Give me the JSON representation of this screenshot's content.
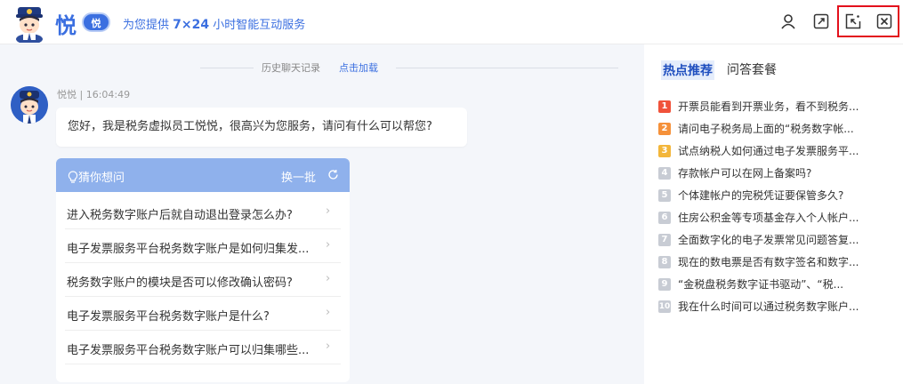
{
  "header": {
    "brand": "悦",
    "badge": "悦",
    "slogan_pre": "为您提供 ",
    "slogan_bold": "7×24",
    "slogan_post": " 小时智能互动服务"
  },
  "chat": {
    "history_text": "历史聊天记录",
    "history_link": "点击加载",
    "meta": "悦悦 | 16:04:49",
    "greeting": "您好，我是税务虚拟员工悦悦，很高兴为您服务，请问有什么可以帮您?",
    "guess": {
      "title": "猜你想问",
      "refresh_label": "换一批",
      "items": [
        "进入税务数字账户后就自动退出登录怎么办?",
        "电子发票服务平台税务数字账户是如何归集发...",
        "税务数字账户的模块是否可以修改确认密码?",
        "电子发票服务平台税务数字账户是什么?",
        "电子发票服务平台税务数字账户可以归集哪些..."
      ],
      "arrow": "›"
    }
  },
  "right_panel": {
    "tabs": [
      "热点推荐",
      "问答套餐"
    ],
    "hot_items": [
      {
        "num": "1",
        "text": "开票员能看到开票业务，看不到税务..."
      },
      {
        "num": "2",
        "text": "请问电子税务局上面的“税务数字帐..."
      },
      {
        "num": "3",
        "text": "试点纳税人如何通过电子发票服务平..."
      },
      {
        "num": "4",
        "text": "存款帐户可以在网上备案吗?"
      },
      {
        "num": "5",
        "text": "个体建帐户的完税凭证要保管多久?"
      },
      {
        "num": "6",
        "text": "住房公积金等专项基金存入个人帐户..."
      },
      {
        "num": "7",
        "text": "全面数字化的电子发票常见问题答复..."
      },
      {
        "num": "8",
        "text": "现在的数电票是否有数字签名和数字..."
      },
      {
        "num": "9",
        "text": "“金税盘税务数字证书驱动”、“税..."
      },
      {
        "num": "10",
        "text": "我在什么时间可以通过税务数字账户..."
      }
    ],
    "rank_colors": {
      "1": "#f0523a",
      "2": "#f5913a",
      "3": "#f3b63a",
      "other": "#c8ccd4"
    }
  },
  "icons": {
    "user": "user-icon",
    "expand": "expand-icon",
    "minimize": "minimize-icon",
    "close": "close-icon"
  }
}
